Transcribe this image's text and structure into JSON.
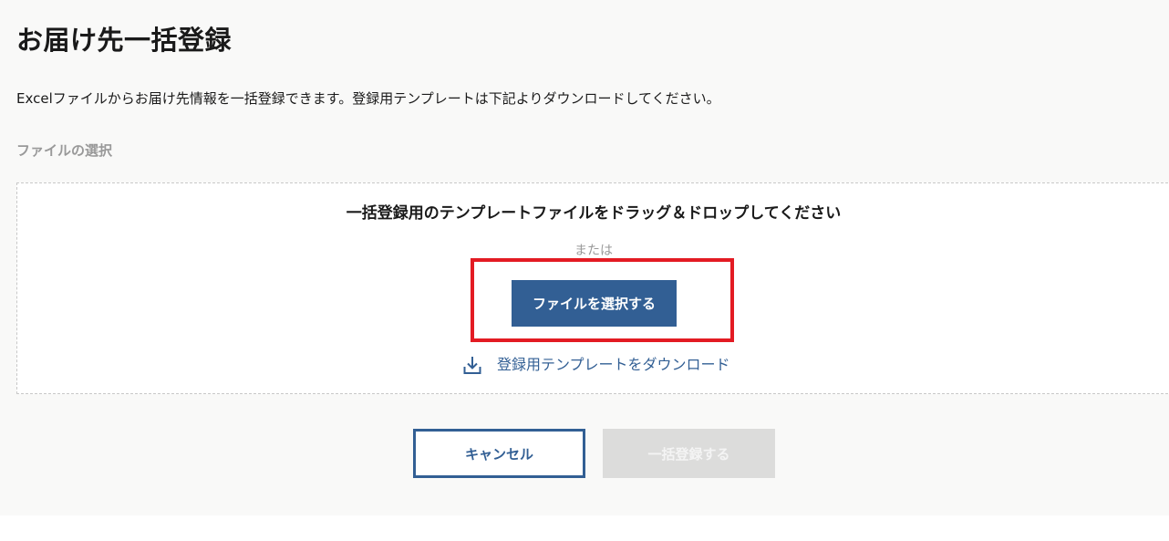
{
  "page": {
    "title": "お届け先一括登録",
    "description": "Excelファイルからお届け先情報を一括登録できます。登録用テンプレートは下記よりダウンロードしてください。",
    "section_label": "ファイルの選択"
  },
  "dropzone": {
    "heading": "一括登録用のテンプレートファイルをドラッグ＆ドロップしてください",
    "or_text": "または",
    "select_button_label": "ファイルを選択する",
    "download_icon": "download-icon",
    "download_label": "登録用テンプレートをダウンロード"
  },
  "actions": {
    "cancel_label": "キャンセル",
    "submit_label": "一括登録する",
    "submit_disabled": true
  },
  "colors": {
    "primary": "#325f94",
    "highlight": "#e31b23",
    "disabled_bg": "#dcdcdb",
    "muted_text": "#999999"
  }
}
